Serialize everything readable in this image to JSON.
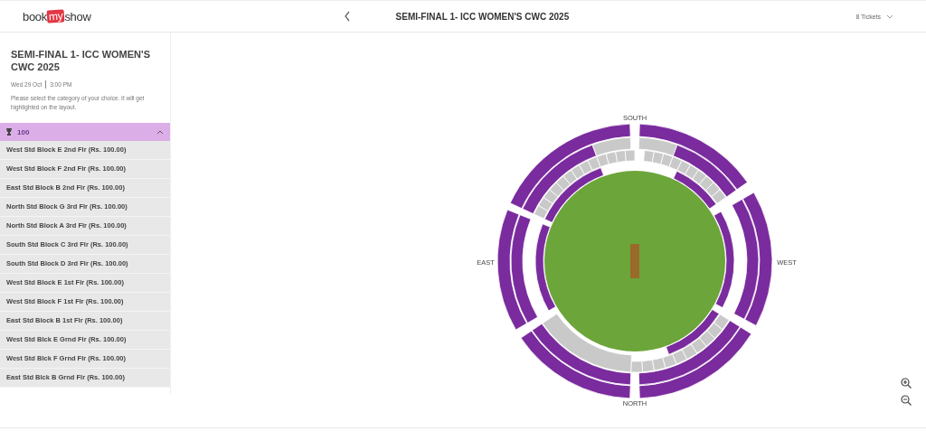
{
  "header": {
    "logo": [
      "book",
      "my",
      "show"
    ],
    "title": "SEMI-FINAL 1- ICC WOMEN'S CWC 2025",
    "tickets": "8 Tickets"
  },
  "event": {
    "title": "SEMI-FINAL 1- ICC WOMEN'S CWC 2025",
    "date": "Wed 29 Oct",
    "time": "3:00 PM",
    "instruction": "Please select the category of your choice. It will get highlighted on the layout."
  },
  "category": {
    "label": "100",
    "expanded": true,
    "items": [
      "West Std Block E 2nd Flr (Rs. 100.00)",
      "West Std Block F 2nd Flr (Rs. 100.00)",
      "East Std Block B 2nd Flr (Rs. 100.00)",
      "North Std Block G 3rd Flr (Rs. 100.00)",
      "North Std Block A 3rd Flr (Rs. 100.00)",
      "South Std Block C 3rd Flr (Rs. 100.00)",
      "South Std Block D 3rd Flr (Rs. 100.00)",
      "West Std Block E 1st Flr (Rs. 100.00)",
      "West Std Block F 1st Flr (Rs. 100.00)",
      "East Std Block B 1st Flr (Rs. 100.00)",
      "West Std Blck E Grnd Flr (Rs. 100.00)",
      "West Std Blck F Grnd Flr (Rs. 100.00)",
      "East Std Blck B Grnd Flr (Rs. 100.00)"
    ]
  },
  "map": {
    "directions": [
      {
        "label": "SOUTH",
        "kind": "top"
      },
      {
        "label": "EAST",
        "kind": "left"
      },
      {
        "label": "WEST",
        "kind": "right"
      },
      {
        "label": "NORTH",
        "kind": "bottom"
      }
    ]
  }
}
